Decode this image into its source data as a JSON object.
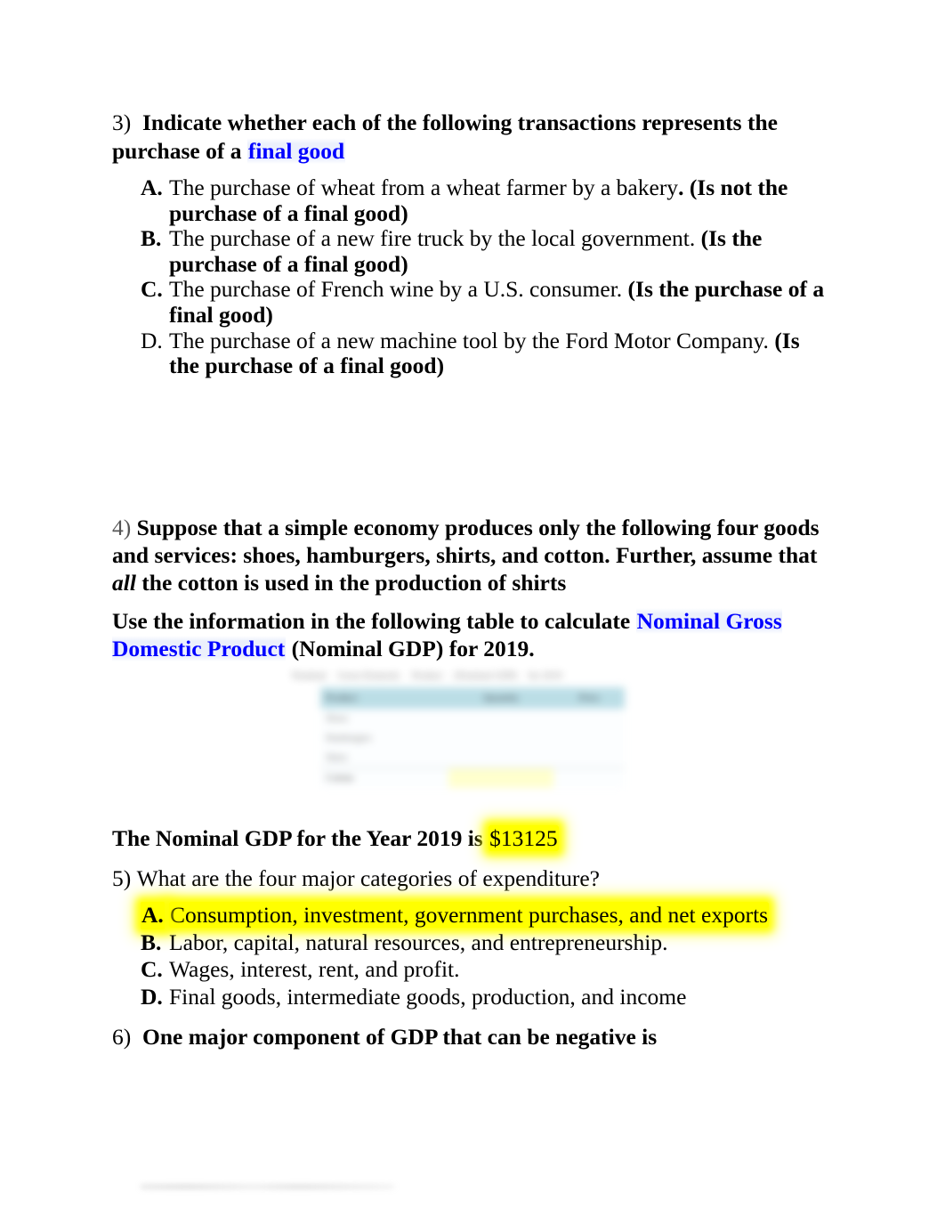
{
  "document": {
    "questions": [
      {
        "number": "3)",
        "stem_lead": "Indicate whether each of the following transactions represents the purchase of a ",
        "stem_highlight": "final good",
        "options": [
          {
            "marker": "A.",
            "marker_bold": true,
            "text": "The purchase of wheat from a wheat farmer by a bakery",
            "answer": ". (Is not the purchase of a final good)"
          },
          {
            "marker": "B.",
            "marker_bold": true,
            "text": "The purchase of a new fire truck by the local government.",
            "answer": " (Is the purchase of a final good)"
          },
          {
            "marker": "C.",
            "marker_bold": true,
            "text": "The purchase of French wine by a U.S. consumer.",
            "answer": " (Is the purchase of a final good)"
          },
          {
            "marker": "D.",
            "marker_bold": false,
            "text": "The purchase of a new machine tool by the Ford Motor Company.",
            "answer": " (Is the purchase of a final good)"
          }
        ]
      },
      {
        "number": "4)",
        "stem_part1": "Suppose that a simple economy produces only the following four goods and services: shoes,  hamburgers, shirts, and cotton. Further, assume that ",
        "stem_italic": "all",
        "stem_part2": " the cotton is used in the production of shirts",
        "instruction_lead": "Use the information in the following table to calculate ",
        "instruction_highlight": "Nominal Gross Domestic Product",
        "instruction_tail": " (Nominal GDP) for 2019.",
        "answer_lead": "The Nominal GDP for the Year 2019 is ",
        "answer_value": "$13125"
      },
      {
        "number": "5)",
        "stem": "What are the four major categories of expenditure?",
        "options": [
          {
            "marker": "A.",
            "text": "Consumption, investment, government purchases, and net exports",
            "highlighted": true
          },
          {
            "marker": "B.",
            "text": "Labor, capital, natural resources, and entrepreneurship.",
            "highlighted": false
          },
          {
            "marker": "C.",
            "text": "Wages, interest,  rent, and profit.",
            "highlighted": false
          },
          {
            "marker": "D.",
            "text": "Final goods, intermediate goods, production, and income",
            "highlighted": false
          }
        ]
      },
      {
        "number": "6)",
        "stem": "One major component of GDP that can be negative is"
      }
    ],
    "table_figure": {
      "blurred": true,
      "caption_fragments": [
        "Nominal",
        "Gross Domestic",
        "Product",
        "(Nominal GDP)",
        "for 2019"
      ],
      "headers": [
        "Product",
        "Quantity",
        "Price"
      ],
      "rows": [
        [
          "Shoes",
          "",
          ""
        ],
        [
          "Hamburgers",
          "",
          ""
        ],
        [
          "Shirts",
          "",
          ""
        ],
        [
          "Cotton",
          "",
          ""
        ]
      ]
    },
    "colors": {
      "link_blue": "#0000ff",
      "highlight_yellow": "#ffff00",
      "table_header_cyan": "#b9dde6",
      "text_black": "#000000"
    }
  }
}
